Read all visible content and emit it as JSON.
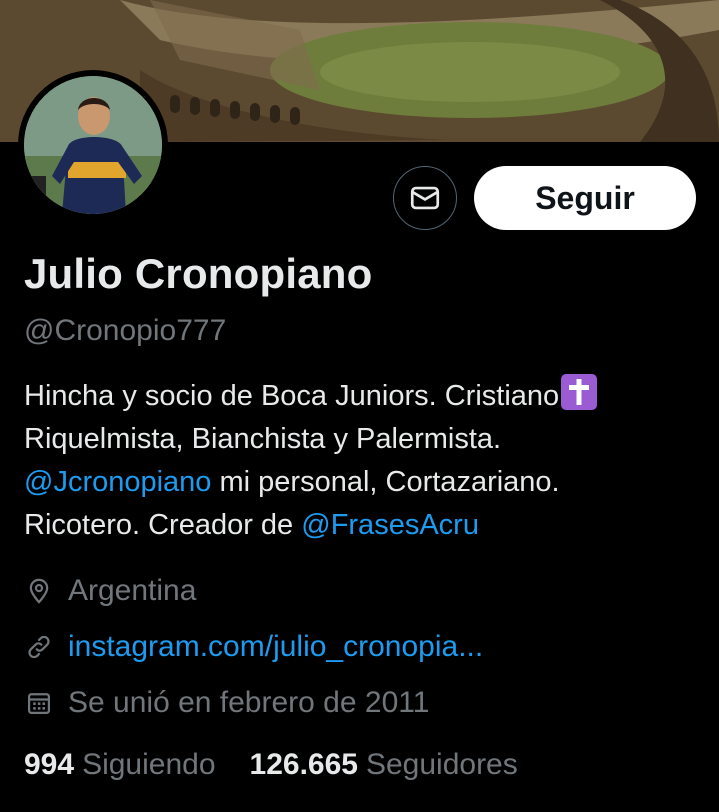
{
  "profile": {
    "name": "Julio Cronopiano",
    "handle": "@Cronopio777",
    "follow_label": "Seguir"
  },
  "bio": {
    "line1": "Hincha y socio de Boca Juniors. Cristiano",
    "line2": "Riquelmista, Bianchista y Palermista.",
    "mention1": "@Jcronopiano",
    "line3_rest": " mi personal, Cortazariano.",
    "line4_start": "Ricotero. Creador de ",
    "mention2": "@FrasesAcru"
  },
  "meta": {
    "location": "Argentina",
    "website": "instagram.com/julio_cronopia...",
    "joined": "Se unió en febrero de 2011"
  },
  "stats": {
    "following_count": "994",
    "following_label": "Siguiendo",
    "followers_count": "126.665",
    "followers_label": "Seguidores"
  },
  "icons": {
    "message": "envelope-icon",
    "location": "map-pin-icon",
    "link": "link-icon",
    "calendar": "calendar-icon"
  },
  "colors": {
    "background": "#000000",
    "link": "#1d9bf0",
    "muted": "#71767b",
    "cross_emoji_bg": "#9b5bd3"
  }
}
